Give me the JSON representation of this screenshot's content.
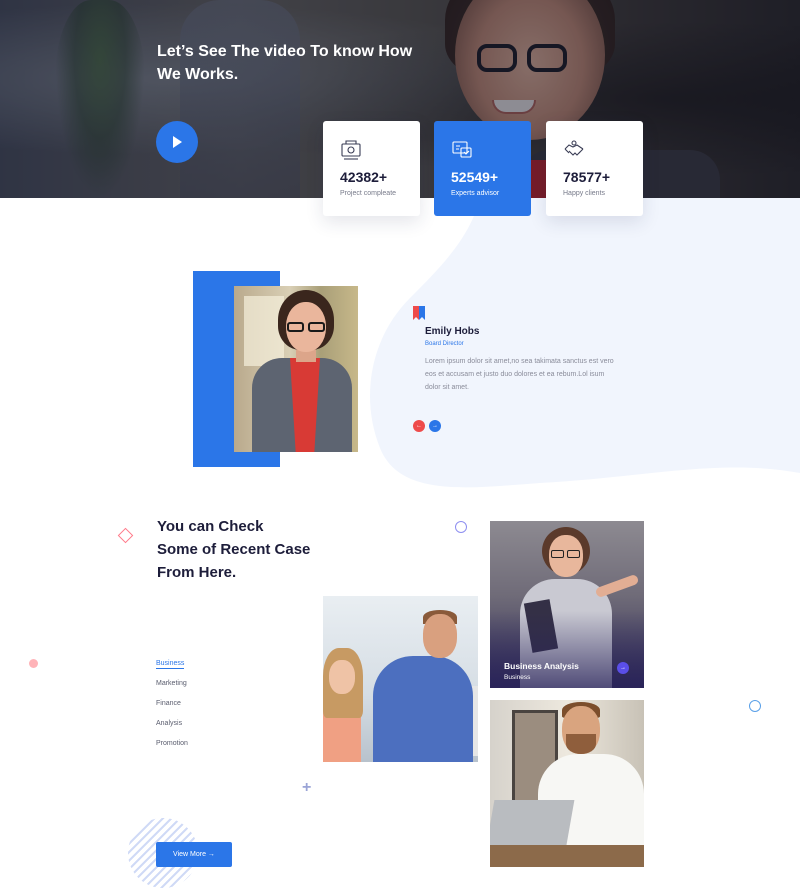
{
  "hero": {
    "title_line1": "Let’s See The video To know How",
    "title_line2": "We Works.",
    "play_icon": "play-icon"
  },
  "stats": [
    {
      "value": "42382+",
      "label": "Project compleate",
      "icon": "project-icon",
      "active": false
    },
    {
      "value": "52549+",
      "label": "Experts advisor",
      "icon": "advisor-icon",
      "active": true
    },
    {
      "value": "78577+",
      "label": "Happy clients",
      "icon": "handshake-icon",
      "active": false
    }
  ],
  "team": {
    "name": "Emily Hobs",
    "role": "Board Director",
    "text": "Lorem ipsum dolor sit amet,no sea takimata sanctus est vero eos et accusam et justo duo dolores et ea rebum.Lol isum dolor sit amet.",
    "prev_label": "←",
    "next_label": "→"
  },
  "cases": {
    "title_line1": "You can Check",
    "title_line2": "Some of Recent Case",
    "title_line3": "From Here.",
    "categories": [
      "Business",
      "Marketing",
      "Finance",
      "Analysis",
      "Promotion"
    ],
    "active_category": "Business",
    "button_label": "View More →",
    "featured": {
      "title": "Business Analysis",
      "subtitle": "Business",
      "arrow": "→"
    }
  },
  "colors": {
    "primary": "#2b76e8",
    "accent_red": "#ee4b4b",
    "dark_text": "#1d1d3a"
  }
}
